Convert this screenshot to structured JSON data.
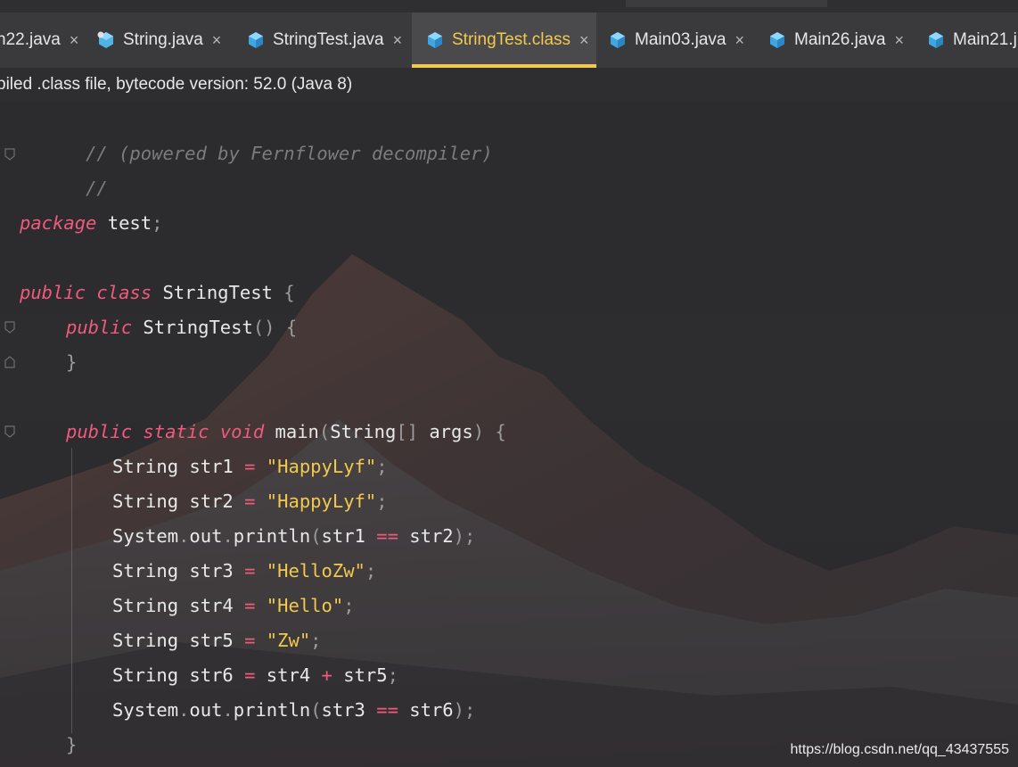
{
  "tabs": [
    {
      "label": "n22.java",
      "icon": "java-file-icon",
      "active": false
    },
    {
      "label": "String.java",
      "icon": "java-class-modified-icon",
      "active": false
    },
    {
      "label": "StringTest.java",
      "icon": "java-file-icon",
      "active": false
    },
    {
      "label": "StringTest.class",
      "icon": "class-file-icon",
      "active": true
    },
    {
      "label": "Main03.java",
      "icon": "java-file-icon",
      "active": false
    },
    {
      "label": "Main26.java",
      "icon": "java-file-icon",
      "active": false
    },
    {
      "label": "Main21.j",
      "icon": "java-file-icon",
      "active": false
    }
  ],
  "tab_close_glyph": "×",
  "banner": {
    "text": "piled .class file, bytecode version: 52.0 (Java 8)"
  },
  "code": {
    "l1": "// (powered by Fernflower decompiler)",
    "l2": "//",
    "l4_kw": "package",
    "l4_name": " test",
    "l4_semi": ";",
    "l6_kw1": "public",
    "l6_kw2": "class",
    "l6_name": " StringTest ",
    "l6_brace": "{",
    "l7_kw": "public",
    "l7_name": " StringTest",
    "l7_paren": "() {",
    "l8": "}",
    "l10_kw1": "public",
    "l10_kw2": "static",
    "l10_kw3": "void",
    "l10_name": " main",
    "l10_p1": "(",
    "l10_type": "String",
    "l10_br": "[]",
    "l10_arg": " args",
    "l10_p2": ") {",
    "l11_decl": "String str1 ",
    "l11_eq": "=",
    "l11_str": " \"HappyLyf\"",
    "l11_semi": ";",
    "l12_decl": "String str2 ",
    "l12_eq": "=",
    "l12_str": " \"HappyLyf\"",
    "l12_semi": ";",
    "l13_a": "System",
    "l13_dot1": ".",
    "l13_b": "out",
    "l13_dot2": ".",
    "l13_c": "println",
    "l13_p1": "(",
    "l13_d": "str1 ",
    "l13_op": "==",
    "l13_e": " str2",
    "l13_p2": ");",
    "l14_decl": "String str3 ",
    "l14_eq": "=",
    "l14_str": " \"HelloZw\"",
    "l14_semi": ";",
    "l15_decl": "String str4 ",
    "l15_eq": "=",
    "l15_str": " \"Hello\"",
    "l15_semi": ";",
    "l16_decl": "String str5 ",
    "l16_eq": "=",
    "l16_str": " \"Zw\"",
    "l16_semi": ";",
    "l17_decl": "String str6 ",
    "l17_eq": "=",
    "l17_a": " str4 ",
    "l17_op": "+",
    "l17_b": " str5",
    "l17_semi": ";",
    "l18_a": "System",
    "l18_dot1": ".",
    "l18_b": "out",
    "l18_dot2": ".",
    "l18_c": "println",
    "l18_p1": "(",
    "l18_d": "str3 ",
    "l18_op": "==",
    "l18_e": " str6",
    "l18_p2": ");",
    "l19": "}"
  },
  "watermark": "https://blog.csdn.net/qq_43437555",
  "colors": {
    "keyword": "#f05a7e",
    "string": "#f2c94c",
    "active_tab": "#f2c94c",
    "comment": "#7c7c7c"
  }
}
